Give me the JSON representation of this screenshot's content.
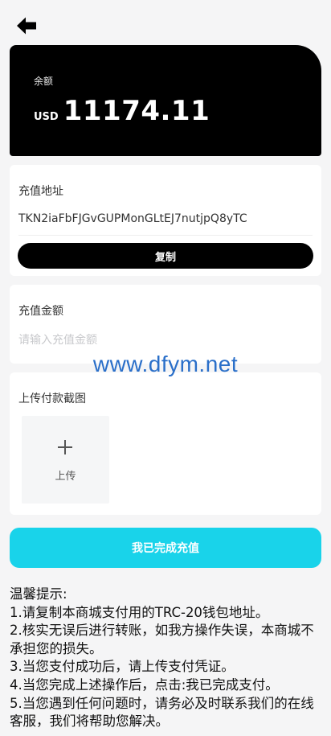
{
  "balance": {
    "label": "余额",
    "currency": "USD",
    "amount": "11174.11"
  },
  "address": {
    "title": "充值地址",
    "value": "TKN2iaFbFJGvGUPMonGLtEJ7nutjpQ8yTC",
    "copy_label": "复制"
  },
  "recharge": {
    "title": "充值金额",
    "placeholder": "请输入充值金额"
  },
  "watermark": "www.dfym.net",
  "upload": {
    "title": "上传付款截图",
    "button_label": "上传"
  },
  "confirm_label": "我已完成充值",
  "tips": {
    "title": "温馨提示:",
    "items": [
      "1.请复制本商城支付用的TRC-20钱包地址。",
      "2.核实无误后进行转账，如我方操作失误，本商城不承担您的损失。",
      "3.当您支付成功后，请上传支付凭证。",
      "4.当您完成上述操作后，点击:我已完成支付。",
      "5.当您遇到任何问题时，请务必及时联系我们的在线客服，我们将帮助您解决。"
    ]
  },
  "icons": {
    "back": "arrow-left-icon",
    "upload": "plus-icon"
  },
  "colors": {
    "accent": "#19d3ea",
    "card_dark": "#000000",
    "watermark": "#2a6fc9"
  }
}
